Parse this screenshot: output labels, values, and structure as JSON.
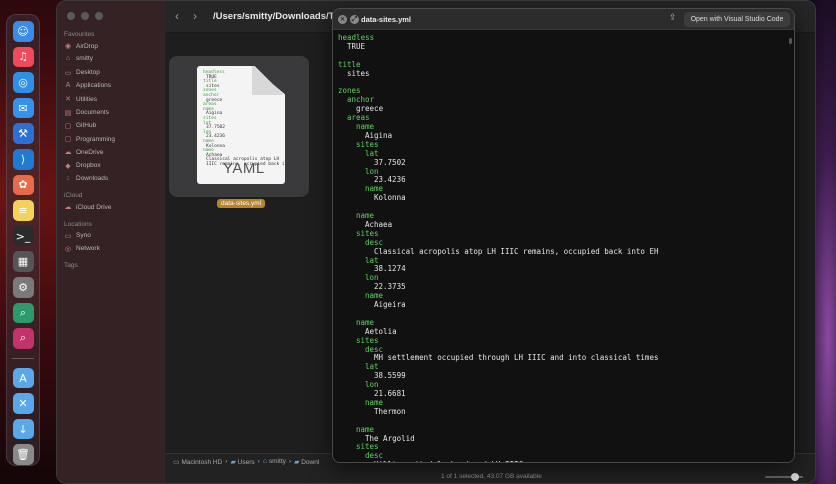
{
  "dock": {
    "apps": [
      {
        "name": "finder",
        "glyph": "☺",
        "color": "#3b8be8"
      },
      {
        "name": "music",
        "glyph": "♫",
        "color": "#f0495c"
      },
      {
        "name": "safari",
        "glyph": "◎",
        "color": "#2f8fe6"
      },
      {
        "name": "mail",
        "glyph": "✉",
        "color": "#3592ea"
      },
      {
        "name": "xcode",
        "glyph": "⚒",
        "color": "#2c6fd6"
      },
      {
        "name": "vscode",
        "glyph": "⟩",
        "color": "#1f7ad0"
      },
      {
        "name": "photos",
        "glyph": "✿",
        "color": "#e86a4a"
      },
      {
        "name": "notes",
        "glyph": "≡",
        "color": "#f3d25a"
      },
      {
        "name": "terminal",
        "glyph": ">_",
        "color": "#2b2b2b"
      },
      {
        "name": "calculator",
        "glyph": "▦",
        "color": "#555555"
      },
      {
        "name": "system-settings",
        "glyph": "⚙",
        "color": "#7a7a7a"
      },
      {
        "name": "zoom-app-1",
        "glyph": "⌕",
        "color": "#2c9a6a"
      },
      {
        "name": "zoom-app-2",
        "glyph": "⌕",
        "color": "#c2336a"
      }
    ],
    "folders": [
      {
        "name": "applications-folder",
        "glyph": "A",
        "color": "#5aa8e8"
      },
      {
        "name": "tools-folder",
        "glyph": "✕",
        "color": "#5aa8e8"
      },
      {
        "name": "downloads-folder",
        "glyph": "↓",
        "color": "#5aa8e8"
      },
      {
        "name": "trash",
        "glyph": "🗑",
        "color": "#8a8a8a"
      }
    ]
  },
  "finder": {
    "sidebar": {
      "favourites_title": "Favourites",
      "favourites": [
        {
          "label": "AirDrop",
          "icon": "◉"
        },
        {
          "label": "smitty",
          "icon": "⌂"
        },
        {
          "label": "Desktop",
          "icon": "▭"
        },
        {
          "label": "Applications",
          "icon": "A"
        },
        {
          "label": "Utilities",
          "icon": "✕"
        },
        {
          "label": "Documents",
          "icon": "▤"
        },
        {
          "label": "GitHub",
          "icon": "▢"
        },
        {
          "label": "Programming",
          "icon": "▢"
        },
        {
          "label": "OneDrive",
          "icon": "☁"
        },
        {
          "label": "Dropbox",
          "icon": "◆"
        },
        {
          "label": "Downloads",
          "icon": "↓"
        }
      ],
      "icloud_title": "iCloud",
      "icloud": [
        {
          "label": "iCloud Drive",
          "icon": "☁"
        }
      ],
      "locations_title": "Locations",
      "locations": [
        {
          "label": "Syno",
          "icon": "▭"
        },
        {
          "label": "Network",
          "icon": "◎"
        }
      ],
      "tags_title": "Tags"
    },
    "toolbar": {
      "back": "‹",
      "forward": "›",
      "path_title": "/Users/smitty/Downloads/Test"
    },
    "file": {
      "name": "data-sites.yml",
      "badge": "YAML",
      "preview_lines": [
        {
          "text": "headless",
          "key": true
        },
        {
          "text": "TRUE",
          "key": false
        },
        {
          "text": "title",
          "key": true
        },
        {
          "text": "sites",
          "key": false
        },
        {
          "text": "zones",
          "key": true
        },
        {
          "text": "anchor",
          "key": true
        },
        {
          "text": "greece",
          "key": false
        },
        {
          "text": "areas",
          "key": true
        },
        {
          "text": "name",
          "key": true
        },
        {
          "text": "Aigina",
          "key": false
        },
        {
          "text": "sites",
          "key": true
        },
        {
          "text": "lat",
          "key": true
        },
        {
          "text": "37.7502",
          "key": false
        },
        {
          "text": "lon",
          "key": true
        },
        {
          "text": "23.4236",
          "key": false
        },
        {
          "text": "name",
          "key": true
        },
        {
          "text": "Kolonna",
          "key": false
        },
        {
          "text": "name",
          "key": true
        },
        {
          "text": "Achaea",
          "key": false
        },
        {
          "text": "Classical acropolis atop LH",
          "key": false
        },
        {
          "text": "IIIC remains, occupied back into EH",
          "key": false
        }
      ]
    },
    "pathbar": [
      {
        "label": "Macintosh HD",
        "icon": "▭"
      },
      {
        "label": "Users",
        "icon": "▰"
      },
      {
        "label": "smitty",
        "icon": "⌂"
      },
      {
        "label": "Downl",
        "icon": "▰"
      }
    ],
    "pathbar_sep": "›",
    "status": "1 of 1 selected, 43.07 GB available"
  },
  "quicklook": {
    "title": "data-sites.yml",
    "close_glyph": "×",
    "fullscreen_glyph": "⤢",
    "share_glyph": "⇪",
    "open_label": "Open with Visual Studio Code",
    "lines": [
      {
        "t": "headless",
        "k": true,
        "i": 0
      },
      {
        "t": "TRUE",
        "k": false,
        "i": 1
      },
      {
        "t": "",
        "k": false,
        "i": 0
      },
      {
        "t": "title",
        "k": true,
        "i": 0
      },
      {
        "t": "sites",
        "k": false,
        "i": 1
      },
      {
        "t": "",
        "k": false,
        "i": 0
      },
      {
        "t": "zones",
        "k": true,
        "i": 0
      },
      {
        "t": "anchor",
        "k": true,
        "i": 1
      },
      {
        "t": "greece",
        "k": false,
        "i": 2
      },
      {
        "t": "areas",
        "k": true,
        "i": 1
      },
      {
        "t": "name",
        "k": true,
        "i": 2
      },
      {
        "t": "Aigina",
        "k": false,
        "i": 3
      },
      {
        "t": "sites",
        "k": true,
        "i": 2
      },
      {
        "t": "lat",
        "k": true,
        "i": 3
      },
      {
        "t": "37.7502",
        "k": false,
        "i": 4
      },
      {
        "t": "lon",
        "k": true,
        "i": 3
      },
      {
        "t": "23.4236",
        "k": false,
        "i": 4
      },
      {
        "t": "name",
        "k": true,
        "i": 3
      },
      {
        "t": "Kolonna",
        "k": false,
        "i": 4
      },
      {
        "t": "",
        "k": false,
        "i": 0
      },
      {
        "t": "name",
        "k": true,
        "i": 2
      },
      {
        "t": "Achaea",
        "k": false,
        "i": 3
      },
      {
        "t": "sites",
        "k": true,
        "i": 2
      },
      {
        "t": "desc",
        "k": true,
        "i": 3
      },
      {
        "t": "Classical acropolis atop LH IIIC remains, occupied back into EH",
        "k": false,
        "i": 4
      },
      {
        "t": "lat",
        "k": true,
        "i": 3
      },
      {
        "t": "38.1274",
        "k": false,
        "i": 4
      },
      {
        "t": "lon",
        "k": true,
        "i": 3
      },
      {
        "t": "22.3735",
        "k": false,
        "i": 4
      },
      {
        "t": "name",
        "k": true,
        "i": 3
      },
      {
        "t": "Aigeira",
        "k": false,
        "i": 4
      },
      {
        "t": "",
        "k": false,
        "i": 0
      },
      {
        "t": "name",
        "k": true,
        "i": 2
      },
      {
        "t": "Aetolia",
        "k": false,
        "i": 3
      },
      {
        "t": "sites",
        "k": true,
        "i": 2
      },
      {
        "t": "desc",
        "k": true,
        "i": 3
      },
      {
        "t": "MH settlement occupied through LH IIIC and into classical times",
        "k": false,
        "i": 4
      },
      {
        "t": "lat",
        "k": true,
        "i": 3
      },
      {
        "t": "38.5599",
        "k": false,
        "i": 4
      },
      {
        "t": "lon",
        "k": true,
        "i": 3
      },
      {
        "t": "21.6681",
        "k": false,
        "i": 4
      },
      {
        "t": "name",
        "k": true,
        "i": 3
      },
      {
        "t": "Thermon",
        "k": false,
        "i": 4
      },
      {
        "t": "",
        "k": false,
        "i": 0
      },
      {
        "t": "name",
        "k": true,
        "i": 2
      },
      {
        "t": "The Argolid",
        "k": false,
        "i": 3
      },
      {
        "t": "sites",
        "k": true,
        "i": 2
      },
      {
        "t": "desc",
        "k": true,
        "i": 3
      },
      {
        "t": "Hilltop citadel abandoned LH IIIC",
        "k": false,
        "i": 4
      }
    ]
  },
  "colors": {
    "yaml_key": "#5fd35f",
    "yaml_value": "#e6e6e6",
    "file_label_bg": "#b8842a"
  }
}
